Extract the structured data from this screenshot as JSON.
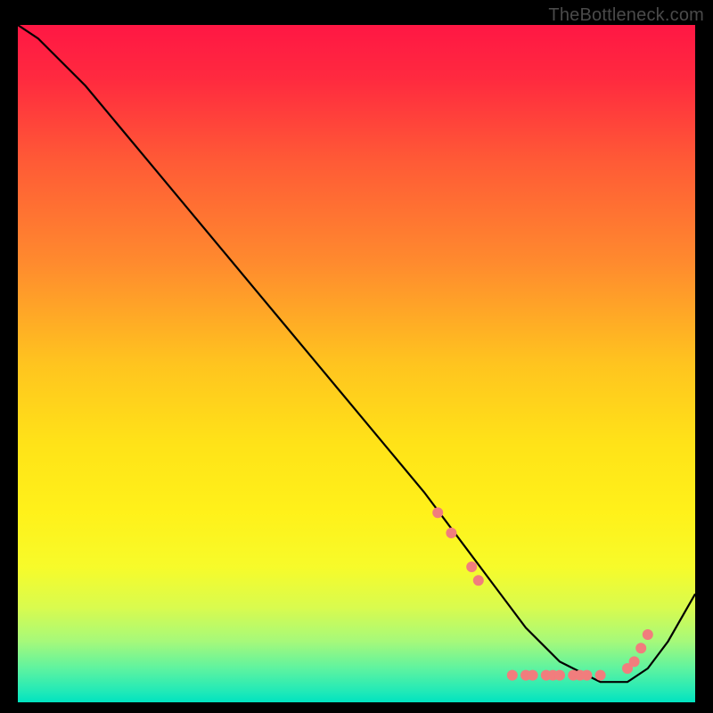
{
  "watermark": "TheBottleneck.com",
  "chart_data": {
    "type": "line",
    "title": "",
    "xlabel": "",
    "ylabel": "",
    "xlim": [
      0,
      100
    ],
    "ylim": [
      0,
      100
    ],
    "grid": false,
    "legend": false,
    "gradient_stops": [
      {
        "offset": 0.0,
        "color": "#ff1744"
      },
      {
        "offset": 0.08,
        "color": "#ff2a3f"
      },
      {
        "offset": 0.2,
        "color": "#ff5a36"
      },
      {
        "offset": 0.35,
        "color": "#ff8a2e"
      },
      {
        "offset": 0.5,
        "color": "#ffc41f"
      },
      {
        "offset": 0.62,
        "color": "#ffe318"
      },
      {
        "offset": 0.72,
        "color": "#fff11a"
      },
      {
        "offset": 0.8,
        "color": "#f7fb2a"
      },
      {
        "offset": 0.86,
        "color": "#d9fb4e"
      },
      {
        "offset": 0.91,
        "color": "#a6f97a"
      },
      {
        "offset": 0.95,
        "color": "#5ef3a0"
      },
      {
        "offset": 0.985,
        "color": "#1fe9b8"
      },
      {
        "offset": 1.0,
        "color": "#00e3c0"
      }
    ],
    "series": [
      {
        "name": "curve",
        "color": "#000000",
        "x": [
          0,
          3,
          6,
          10,
          15,
          20,
          25,
          30,
          35,
          40,
          45,
          50,
          55,
          60,
          63,
          66,
          69,
          72,
          75,
          78,
          80,
          82,
          84,
          86,
          88,
          90,
          93,
          96,
          100
        ],
        "y": [
          100,
          98,
          95,
          91,
          85,
          79,
          73,
          67,
          61,
          55,
          49,
          43,
          37,
          31,
          27,
          23,
          19,
          15,
          11,
          8,
          6,
          5,
          4,
          3,
          3,
          3,
          5,
          9,
          16
        ]
      }
    ],
    "markers": {
      "color": "#f17d7d",
      "radius": 6,
      "points": [
        {
          "x": 62,
          "y": 28
        },
        {
          "x": 64,
          "y": 25
        },
        {
          "x": 67,
          "y": 20
        },
        {
          "x": 68,
          "y": 18
        },
        {
          "x": 73,
          "y": 4
        },
        {
          "x": 75,
          "y": 4
        },
        {
          "x": 76,
          "y": 4
        },
        {
          "x": 78,
          "y": 4
        },
        {
          "x": 79,
          "y": 4
        },
        {
          "x": 80,
          "y": 4
        },
        {
          "x": 82,
          "y": 4
        },
        {
          "x": 83,
          "y": 4
        },
        {
          "x": 84,
          "y": 4
        },
        {
          "x": 86,
          "y": 4
        },
        {
          "x": 90,
          "y": 5
        },
        {
          "x": 91,
          "y": 6
        },
        {
          "x": 92,
          "y": 8
        },
        {
          "x": 93,
          "y": 10
        }
      ]
    }
  }
}
